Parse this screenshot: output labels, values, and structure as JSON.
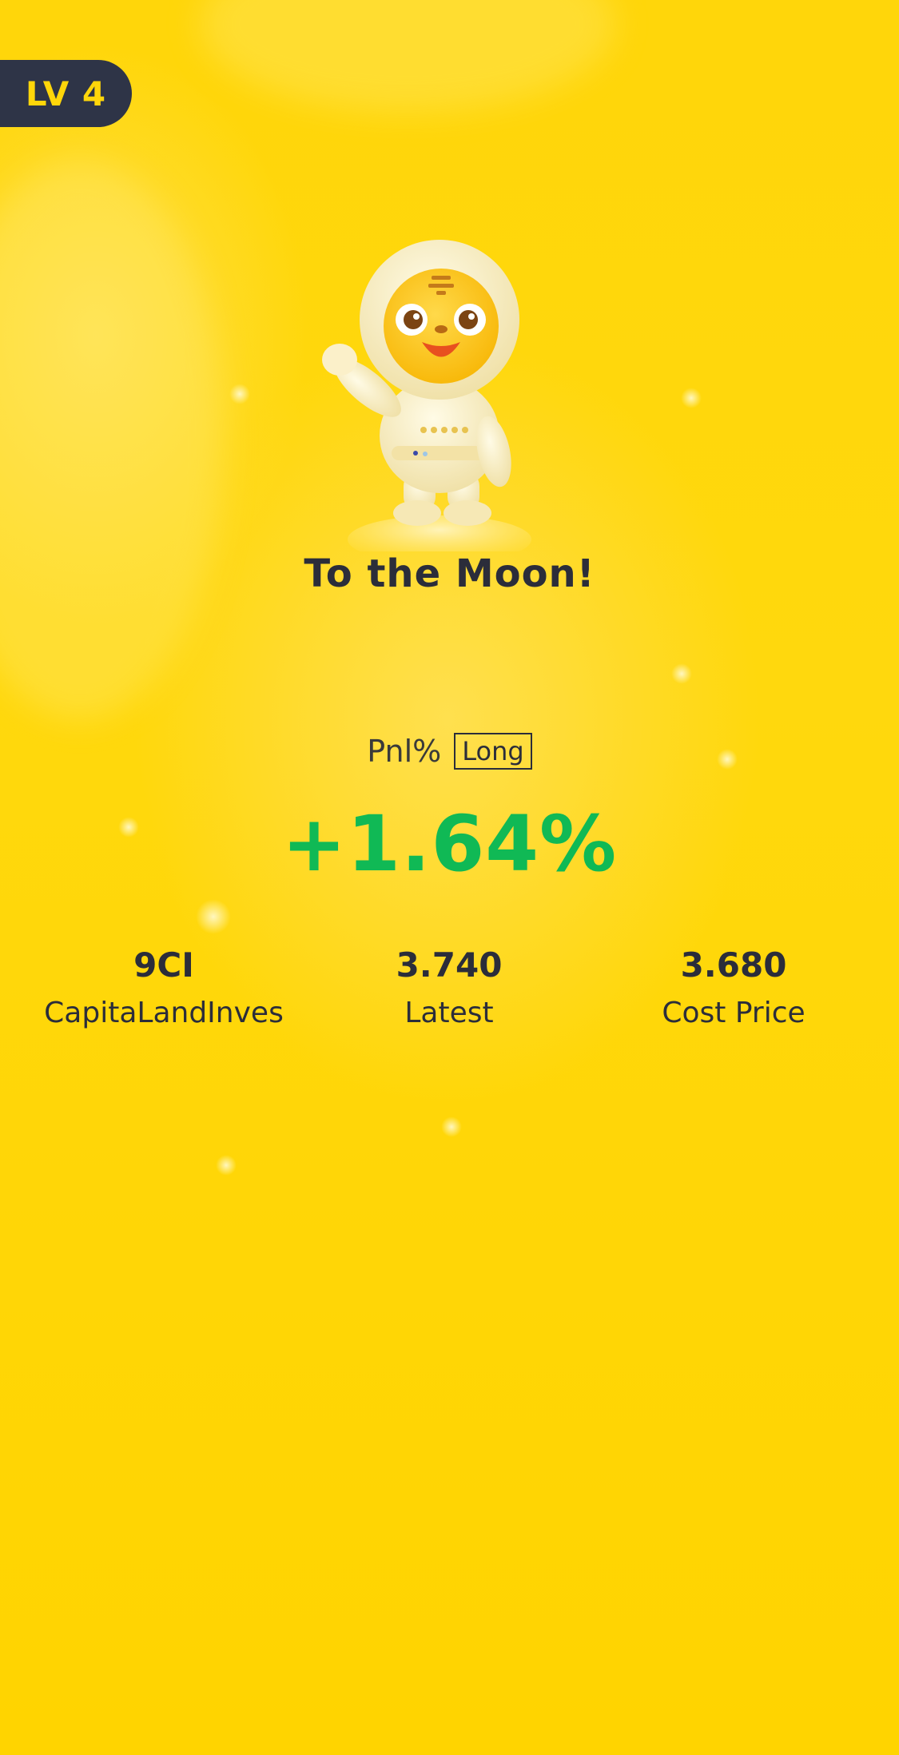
{
  "level_badge": {
    "label": "LV 4"
  },
  "hero": {
    "mascot_icon": "astronaut-tiger-mascot-icon",
    "title": "To the Moon!"
  },
  "pnl": {
    "label": "Pnl%",
    "direction_tag": "Long",
    "value": "+1.64%",
    "value_color": "#10b955"
  },
  "stats": [
    {
      "value": "9CI",
      "label": "CapitaLandInves"
    },
    {
      "value": "3.740",
      "label": "Latest"
    },
    {
      "value": "3.680",
      "label": "Cost Price"
    }
  ],
  "colors": {
    "background": "#ffd60a",
    "badge_bg": "#2e3447",
    "badge_text": "#ffd60a",
    "text_dark": "#2b2d3a",
    "positive": "#10b955"
  }
}
